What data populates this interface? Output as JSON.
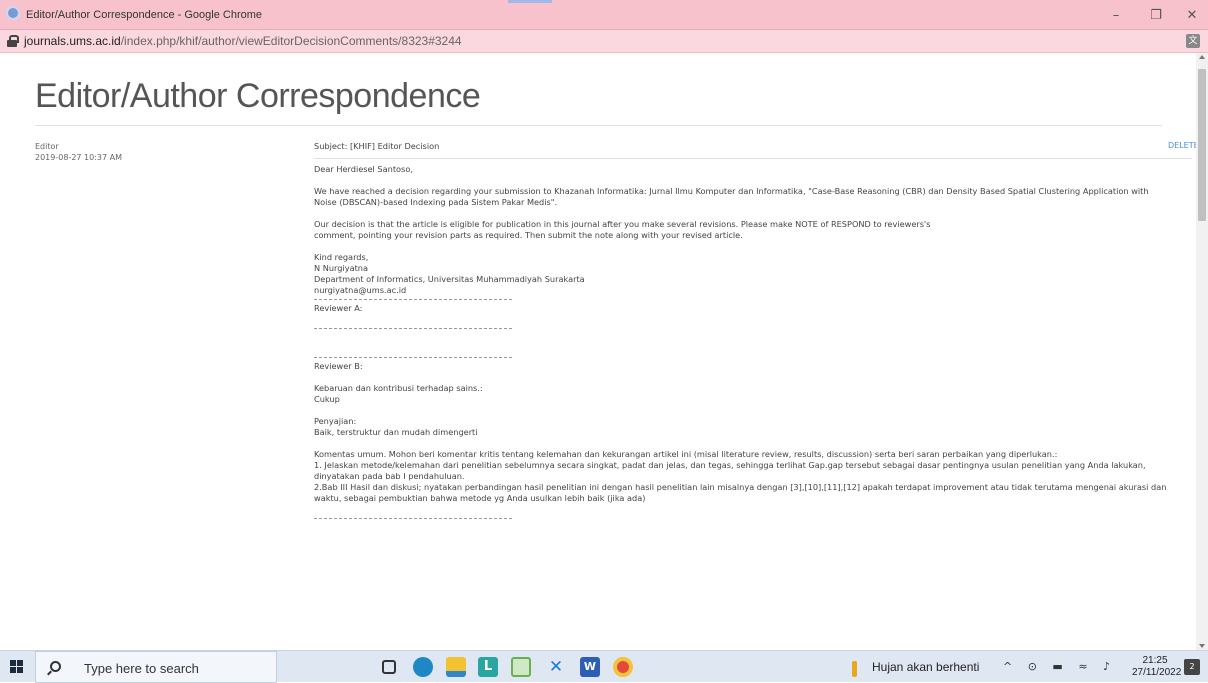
{
  "window": {
    "title": "Editor/Author Correspondence - Google Chrome",
    "minimize": "–",
    "maximize": "❐",
    "close": "✕"
  },
  "address": {
    "host": "journals.ums.ac.id",
    "path": "/index.php/khif/author/viewEditorDecisionComments/8323#3244"
  },
  "page": {
    "heading": "Editor/Author Correspondence",
    "sender_role": "Editor",
    "sender_date": "2019-08-27 10:37 AM",
    "delete_label": "DELETE",
    "subject": "Subject: [KHIF] Editor Decision",
    "lines": [
      "Dear Herdiesel Santoso,",
      "",
      "We have reached a decision regarding your submission to Khazanah Informatika: Jurnal Ilmu Komputer dan Informatika, \"Case-Base Reasoning (CBR) dan Density Based Spatial Clustering Application with",
      "Noise (DBSCAN)-based Indexing pada Sistem Pakar Medis\".",
      "",
      "Our decision is that the article is eligible for publication in this journal after you make several revisions. Please make NOTE of RESPOND to reviewers's",
      "comment, pointing your revision parts as required. Then submit the note along with your revised article.",
      "",
      "Kind regards,",
      "N Nurgiyatna",
      "Department of Informatics, Universitas Muhammadiyah Surakarta",
      "nurgiyatna@ums.ac.id"
    ],
    "reviewer_a": "Reviewer A:",
    "reviewer_b": "Reviewer B:",
    "reviewer_b_lines": [
      "",
      "Kebaruan dan kontribusi terhadap sains.:",
      "Cukup",
      "",
      "Penyajian:",
      "Baik, terstruktur dan mudah dimengerti",
      "",
      "Komentas umum. Mohon beri komentar kritis tentang kelemahan dan kekurangan artikel ini (misal literature review, results, discussion) serta beri saran perbaikan yang diperlukan.:",
      "1. Jelaskan metode/kelemahan dari penelitian sebelumnya secara singkat, padat dan jelas, dan tegas, sehingga terlihat Gap.gap tersebut sebagai dasar pentingnya usulan penelitian yang Anda lakukan,",
      "dinyatakan pada bab I pendahuluan.",
      "2.Bab III Hasil dan diskusi; nyatakan perbandingan hasil penelitian ini dengan hasil penelitian lain misalnya dengan [3],[10],[11],[12] apakah terdapat improvement atau tidak terutama mengenai akurasi dan",
      "waktu, sebagai pembuktian bahwa metode yg Anda usulkan lebih baik (jika ada)"
    ]
  },
  "taskbar": {
    "search_placeholder": "Type here to search",
    "weather": "Hujan akan berhenti",
    "time": "21:25",
    "date": "27/11/2022",
    "notification_count": "2",
    "icons": [
      "task-view-icon",
      "edge-icon",
      "file-explorer-icon",
      "l-app-icon",
      "notepad-icon",
      "vscode-icon",
      "word-icon",
      "chrome-icon"
    ]
  }
}
